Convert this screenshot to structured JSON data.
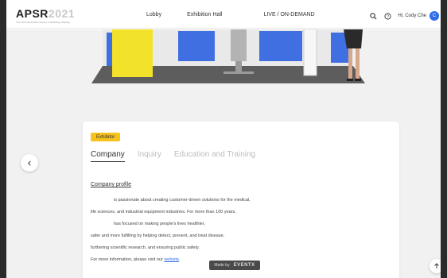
{
  "header": {
    "logo_main": "APSR",
    "logo_year": "2021",
    "logo_tagline": "The 13th Asia-Pacific Society of Radiology Meeting",
    "nav": [
      "Lobby",
      "Exhibition Hall",
      "LIVE / ON-DEMAND"
    ],
    "greeting": "Hi, Cody Che",
    "avatar_initial": "C"
  },
  "booth": {
    "icons": [
      "booth-backdrop",
      "yellow-panel",
      "screen-display",
      "info-kiosk",
      "staff-figure"
    ],
    "colors": {
      "panel": "#f2e22a",
      "wall": "#3f6fe0",
      "floor": "#5d5d5d"
    }
  },
  "card": {
    "badge": "Exhibitor",
    "tabs": [
      "Company",
      "Inquiry",
      "Education and Training"
    ],
    "active_tab": "Company",
    "section_title": "Company profile",
    "description": [
      "is passionate about creating customer-driven solutions for the medical,",
      "life sciences, and industrial equipment industries. For more than 100 years,",
      "has focused on making people's lives healthier,",
      "safer and more fulfilling by helping detect, prevent, and treat disease,",
      "furthering scientific research, and ensuring public safety."
    ],
    "more_info_prefix": "For more information, please visit our ",
    "more_info_link": "website",
    "more_info_suffix": "."
  },
  "footer": {
    "made_by": "Made by",
    "brand": "EVENTX"
  },
  "colors": {
    "accent": "#f6c21c",
    "link": "#2f6ee8"
  }
}
